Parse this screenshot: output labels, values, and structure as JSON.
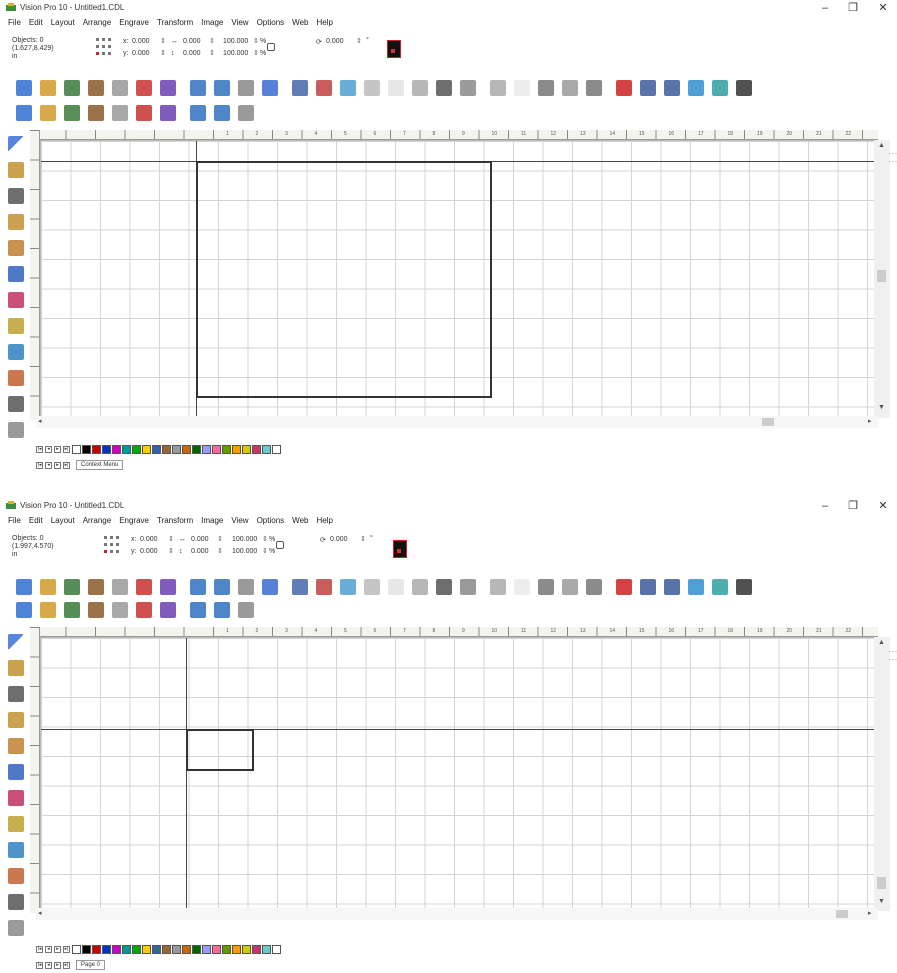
{
  "window": {
    "title": "Vision Pro 10 - Untitled1.CDL",
    "min_glyph": "–",
    "max_glyph": "❐",
    "close_glyph": "✕"
  },
  "menu": [
    "File",
    "Edit",
    "Layout",
    "Arrange",
    "Engrave",
    "Transform",
    "Image",
    "View",
    "Options",
    "Web",
    "Help"
  ],
  "screens": [
    {
      "objects_label": "Objects: 0",
      "coords": "(1.627,8.429)",
      "units": "in",
      "x_value": "0.000",
      "y_value": "0.000",
      "width_value": "0.000",
      "height_value": "0.000",
      "scale_w": "100.000",
      "scale_h": "100.000",
      "rotation": "0.000",
      "degree_symbol": "°",
      "pagebar_label": "Context Menu"
    },
    {
      "objects_label": "Objects: 0",
      "coords": "(1.997,4.570)",
      "units": "in",
      "x_value": "0.000",
      "y_value": "0.000",
      "width_value": "0.000",
      "height_value": "0.000",
      "scale_w": "100.000",
      "scale_h": "100.000",
      "rotation": "0.000",
      "degree_symbol": "°",
      "pagebar_label": "Page 0"
    }
  ],
  "field_labels": {
    "x": "x:",
    "y": "y:",
    "width_arrow": "↔",
    "height_arrow": "↕",
    "percent": "%",
    "rotate": "⟳"
  },
  "ruler_numbers": [
    "1",
    "2",
    "3",
    "4",
    "5",
    "6",
    "7",
    "8",
    "9",
    "10",
    "11",
    "12",
    "13",
    "14",
    "15",
    "16",
    "17",
    "18",
    "19",
    "20",
    "21",
    "22"
  ],
  "toolbar_row1_icons": [
    "new-file-icon",
    "open-file-icon",
    "save-icon",
    "print-icon",
    "cut-icon",
    "marker-icon",
    "layers-icon",
    "undo-icon",
    "redo-icon",
    "weld-icon",
    "trace-icon",
    "node-edit-icon",
    "photo-icon",
    "grid-icon",
    "star-icon",
    "star-outline-icon",
    "text-icon",
    "shape-icon",
    "barcode-icon",
    "table-icon",
    "circle-icon",
    "abc-icon",
    "serial-icon",
    "image-icon",
    "delete-icon",
    "pointer-icon",
    "align-icon",
    "rotate-icon",
    "window-icon",
    "move-icon"
  ],
  "toolbar_row2_icons": [
    "layers-icon",
    "text-flow-icon",
    "stack-icon",
    "fill-icon",
    "engrave-icon",
    "target-icon",
    "home-icon",
    "shape-blue-icon",
    "shape-blue2-icon",
    "stamp-icon"
  ],
  "left_tools": [
    "select-arrow-icon",
    "engrave-tool-icon",
    "text-tool-icon",
    "text-alt-tool-icon",
    "zoom-tool-icon",
    "fill-tool-icon",
    "shape-tool-icon",
    "pen-tool-icon",
    "node-tool-icon",
    "draw-tool-icon",
    "vector-tool-icon",
    "magnify-tool-icon"
  ],
  "palette_colors": [
    "#ffffff",
    "#000000",
    "#cc0000",
    "#0033cc",
    "#cc00cc",
    "#009999",
    "#00aa00",
    "#ffcc00",
    "#336699",
    "#996633",
    "#999999",
    "#cc6600",
    "#006600",
    "#9999ff",
    "#ff6699",
    "#669900",
    "#ff9900",
    "#cccc00",
    "#cc3366",
    "#66cccc",
    "#ffffff"
  ]
}
